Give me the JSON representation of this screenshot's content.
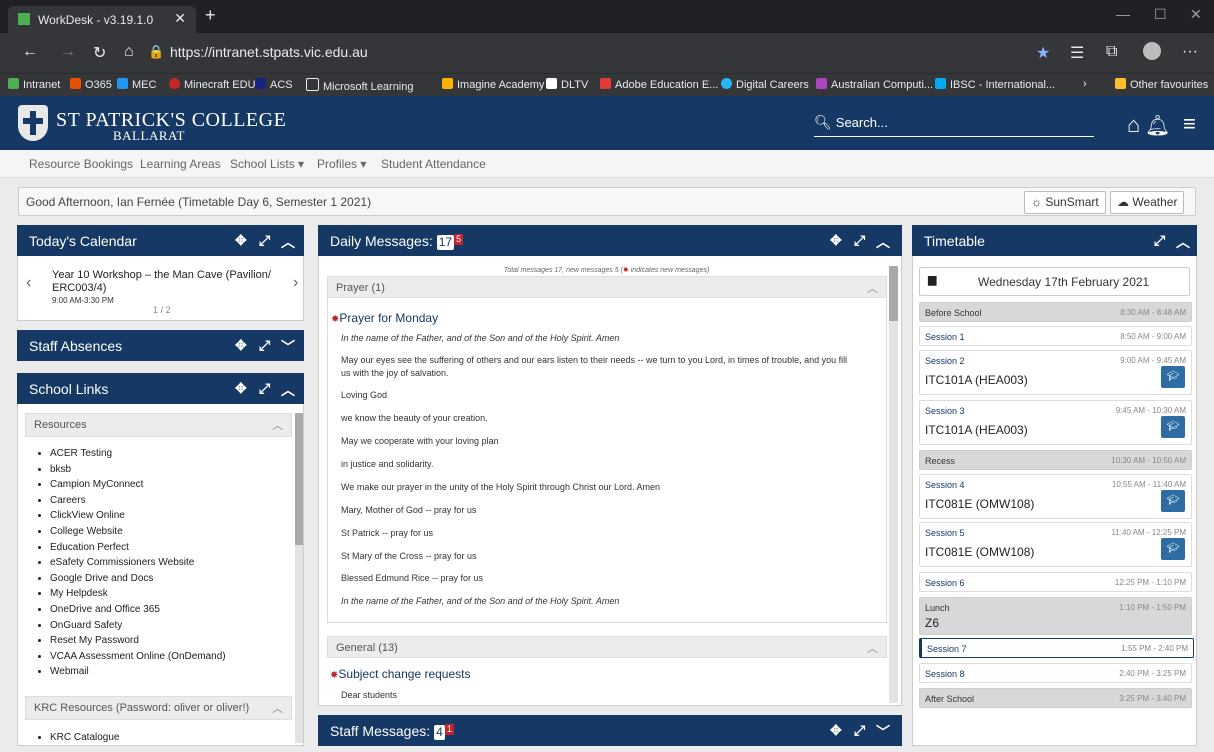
{
  "browser": {
    "tab_title": "WorkDesk - v3.19.1.0",
    "url": "https://intranet.stpats.vic.edu.au",
    "bookmarks": [
      "Intranet",
      "O365",
      "MEC",
      "Minecraft EDU",
      "ACS",
      "Microsoft Learning",
      "Imagine Academy",
      "DLTV",
      "Adobe Education E...",
      "Digital Careers",
      "Australian Computi...",
      "IBSC - International..."
    ],
    "other_favourites": "Other favourites"
  },
  "header": {
    "college_name": "ST PATRICK'S COLLEGE",
    "college_city": "BALLARAT",
    "search_placeholder": "Search..."
  },
  "nav": [
    "Resource Bookings",
    "Learning Areas",
    "School Lists ▾",
    "Profiles ▾",
    "Student Attendance"
  ],
  "greeting": "Good Afternoon, Ian Fernée (Timetable Day 6, Semester 1 2021)",
  "greet_buttons": {
    "sunsmart": "SunSmart",
    "weather": "Weather"
  },
  "calendar": {
    "title": "Today's Calendar",
    "event": "Year 10 Workshop – the Man Cave (Pavilion/",
    "event2": "ERC003/4)",
    "time": "9:00 AM-3:30 PM",
    "pager": "1 / 2"
  },
  "staff_absences": {
    "title": "Staff Absences"
  },
  "school_links": {
    "title": "School Links",
    "section1": "Resources",
    "links": [
      "ACER Testing",
      "bksb",
      "Campion MyConnect",
      "Careers",
      "ClickView Online",
      "College Website",
      "Education Perfect",
      "eSafety Commissioners Website",
      "Google Drive and Docs",
      "My Helpdesk",
      "OneDrive and Office 365",
      "OnGuard Safety",
      "Reset My Password",
      "VCAA Assessment Online (OnDemand)",
      "Webmail"
    ],
    "section2": "KRC Resources (Password: oliver or oliver!)",
    "links2": [
      "KRC Catalogue"
    ]
  },
  "daily_messages": {
    "title": "Daily Messages:",
    "count": "17",
    "new": "5",
    "summary_a": "Total messages 17, new messages 5 (",
    "summary_b": " indicates new messages)",
    "section1": "Prayer (1)",
    "msg1_title": "Prayer for Monday",
    "lines": [
      "In the name of the Father, and of the Son and of the Holy Spirit. Amen",
      "May our eyes see the suffering of others and our ears listen to their needs -- we turn to you Lord, in times of trouble, and you fill",
      "us with the joy of salvation.",
      "Loving God",
      "we know the beauty of your creation.",
      "May we cooperate with your loving plan",
      "in justice and solidarity.",
      "We make our prayer in the unity of the Holy Spirit through Christ our Lord. Amen",
      "Mary, Mother of God -- pray for us",
      "St Patrick -- pray for us",
      "St Mary of the Cross -- pray for us",
      "Blessed Edmund Rice -- pray for us",
      "In the name of the Father, and of the Son and of the Holy Spirit. Amen"
    ],
    "section2": "General (13)",
    "msg2_title": "Subject change requests",
    "msg2_line": "Dear students"
  },
  "staff_messages": {
    "title": "Staff Messages:",
    "count": "4",
    "new": "1"
  },
  "timetable": {
    "title": "Timetable",
    "date": "Wednesday 17th February 2021",
    "slots": [
      {
        "name": "Before School",
        "time": "8:30 AM - 8:48 AM",
        "cls": ""
      },
      {
        "name": "Session 1",
        "time": "8:50 AM - 9:00 AM",
        "cls": ""
      },
      {
        "name": "Session 2",
        "time": "9:00 AM - 9:45 AM",
        "cls": "ITC101A (HEA003)"
      },
      {
        "name": "Session 3",
        "time": "9:45 AM - 10:30 AM",
        "cls": "ITC101A (HEA003)"
      },
      {
        "name": "Recess",
        "time": "10:30 AM - 10:50 AM",
        "cls": ""
      },
      {
        "name": "Session 4",
        "time": "10:55 AM - 11:40 AM",
        "cls": "ITC081E (OMW108)"
      },
      {
        "name": "Session 5",
        "time": "11:40 AM - 12:25 PM",
        "cls": "ITC081E (OMW108)"
      },
      {
        "name": "Session 6",
        "time": "12:25 PM - 1:10 PM",
        "cls": ""
      },
      {
        "name": "Lunch",
        "time": "1:10 PM - 1:50 PM",
        "cls": "Z6"
      },
      {
        "name": "Session 7",
        "time": "1:55 PM - 2:40 PM",
        "cls": ""
      },
      {
        "name": "Session 8",
        "time": "2:40 PM - 3:25 PM",
        "cls": ""
      },
      {
        "name": "After School",
        "time": "3:25 PM - 3:40 PM",
        "cls": ""
      }
    ]
  },
  "colors": {
    "brand": "#153865",
    "new_dot": "#c0272d",
    "class_button": "#2e6da4"
  }
}
